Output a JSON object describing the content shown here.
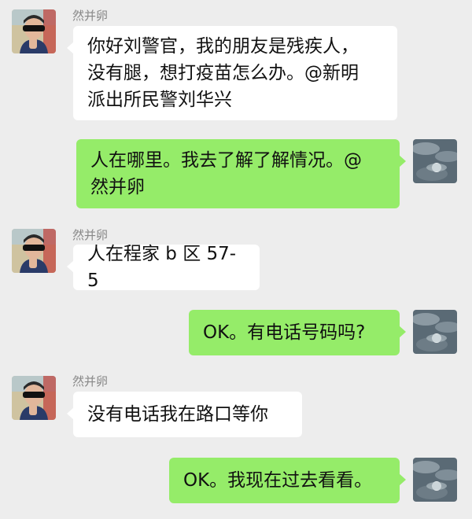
{
  "chat": {
    "messages": [
      {
        "side": "left",
        "sender": "然并卵",
        "text": "你好刘警官，我的朋友是残疾人，\n没有腿，想打疫苗怎么办。@新明\n派出所民警刘华兴"
      },
      {
        "side": "right",
        "text": "人在哪里。我去了解了解情况。@\n然并卵"
      },
      {
        "side": "left",
        "sender": "然并卵",
        "text": "人在程家 b 区 57-5"
      },
      {
        "side": "right",
        "text": "OK。有电话号码吗?"
      },
      {
        "side": "left",
        "sender": "然并卵",
        "text": "没有电话我在路口等你"
      },
      {
        "side": "right",
        "text": "OK。我现在过去看看。"
      }
    ]
  },
  "colors": {
    "background": "#ededed",
    "bubble_left": "#ffffff",
    "bubble_right": "#95ec69",
    "sender_name": "#888888"
  },
  "icons": {
    "left_avatar": "person-sunglasses-avatar-icon",
    "right_avatar": "cloudy-sky-avatar-icon"
  }
}
